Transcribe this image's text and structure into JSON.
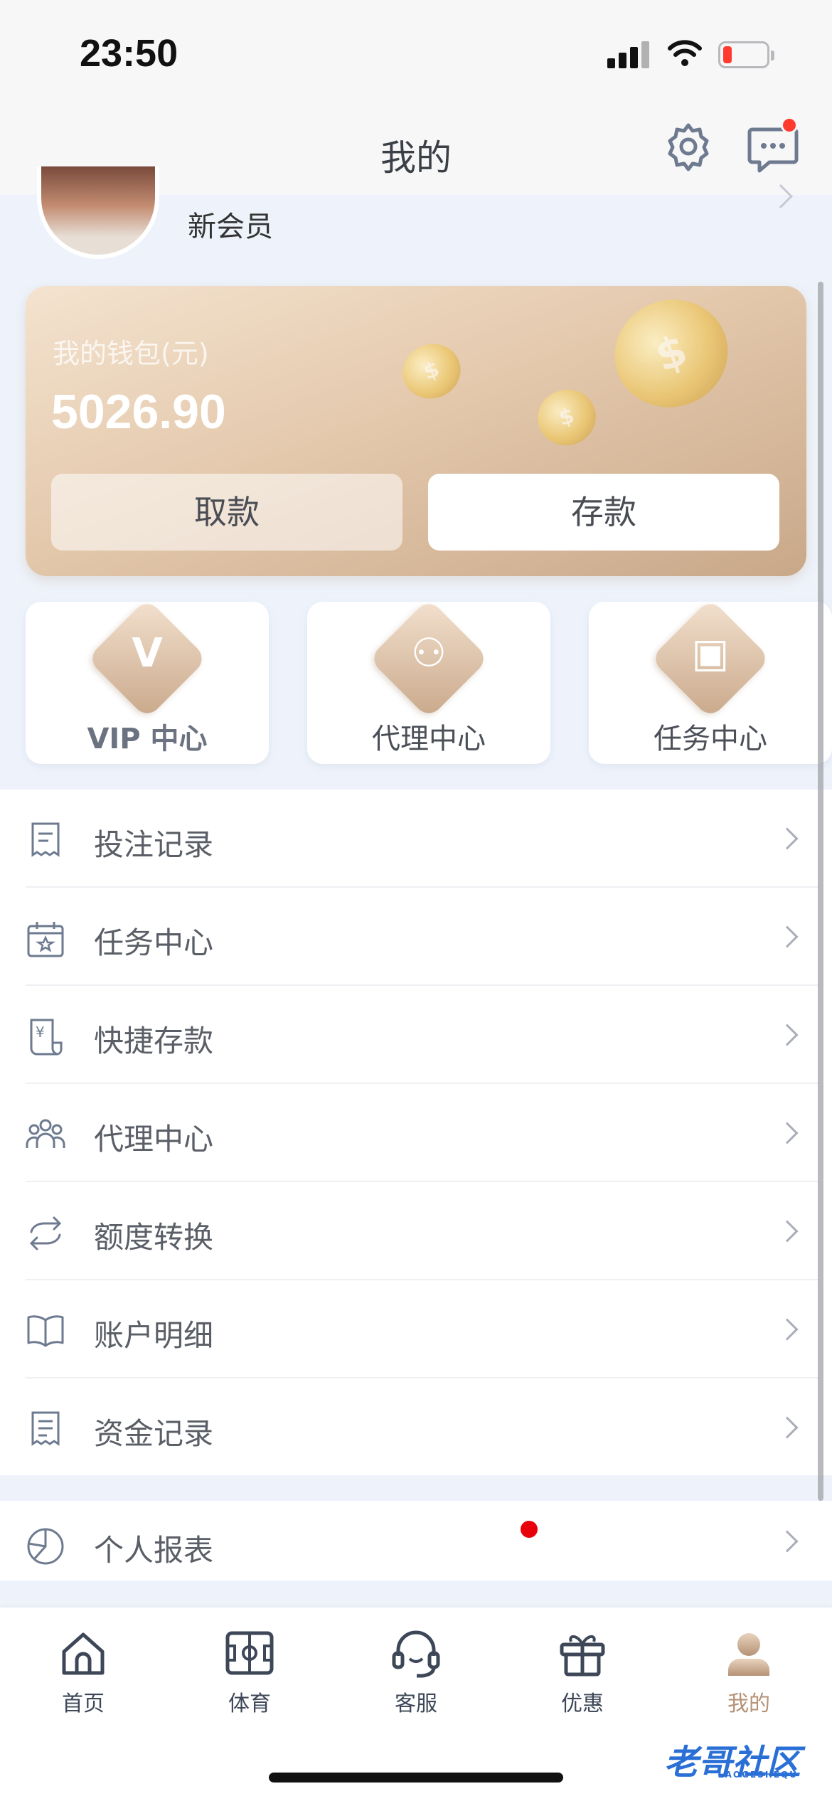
{
  "status_bar": {
    "time": "23:50"
  },
  "navbar": {
    "title": "我的"
  },
  "profile": {
    "member_level": "新会员"
  },
  "wallet": {
    "label": "我的钱包(元)",
    "balance": "5026.90",
    "withdraw_label": "取款",
    "deposit_label": "存款"
  },
  "quick_entries": [
    {
      "label": "VIP 中心",
      "glyph": "V",
      "icon": "vip-diamond-icon"
    },
    {
      "label": "代理中心",
      "glyph": "⚇",
      "icon": "agent-icon"
    },
    {
      "label": "任务中心",
      "glyph": "▣",
      "icon": "task-icon"
    }
  ],
  "menu": [
    {
      "label": "投注记录",
      "icon": "receipt-icon"
    },
    {
      "label": "任务中心",
      "icon": "calendar-star-icon"
    },
    {
      "label": "快捷存款",
      "icon": "yen-receipt-icon"
    },
    {
      "label": "代理中心",
      "icon": "people-icon"
    },
    {
      "label": "额度转换",
      "icon": "transfer-icon"
    },
    {
      "label": "账户明细",
      "icon": "book-icon"
    },
    {
      "label": "资金记录",
      "icon": "document-icon"
    }
  ],
  "menu2": [
    {
      "label": "个人报表",
      "icon": "pie-chart-icon"
    }
  ],
  "tabbar": [
    {
      "label": "首页",
      "icon": "home-icon"
    },
    {
      "label": "体育",
      "icon": "field-icon"
    },
    {
      "label": "客服",
      "icon": "headset-icon"
    },
    {
      "label": "优惠",
      "icon": "gift-icon"
    },
    {
      "label": "我的",
      "icon": "user-icon",
      "active": true
    }
  ],
  "watermark": {
    "text": "老哥社区",
    "sub": "LAOGESHEQU"
  },
  "colors": {
    "accent": "#b59276",
    "background": "#eef3fb",
    "badge": "#ff3b30"
  }
}
